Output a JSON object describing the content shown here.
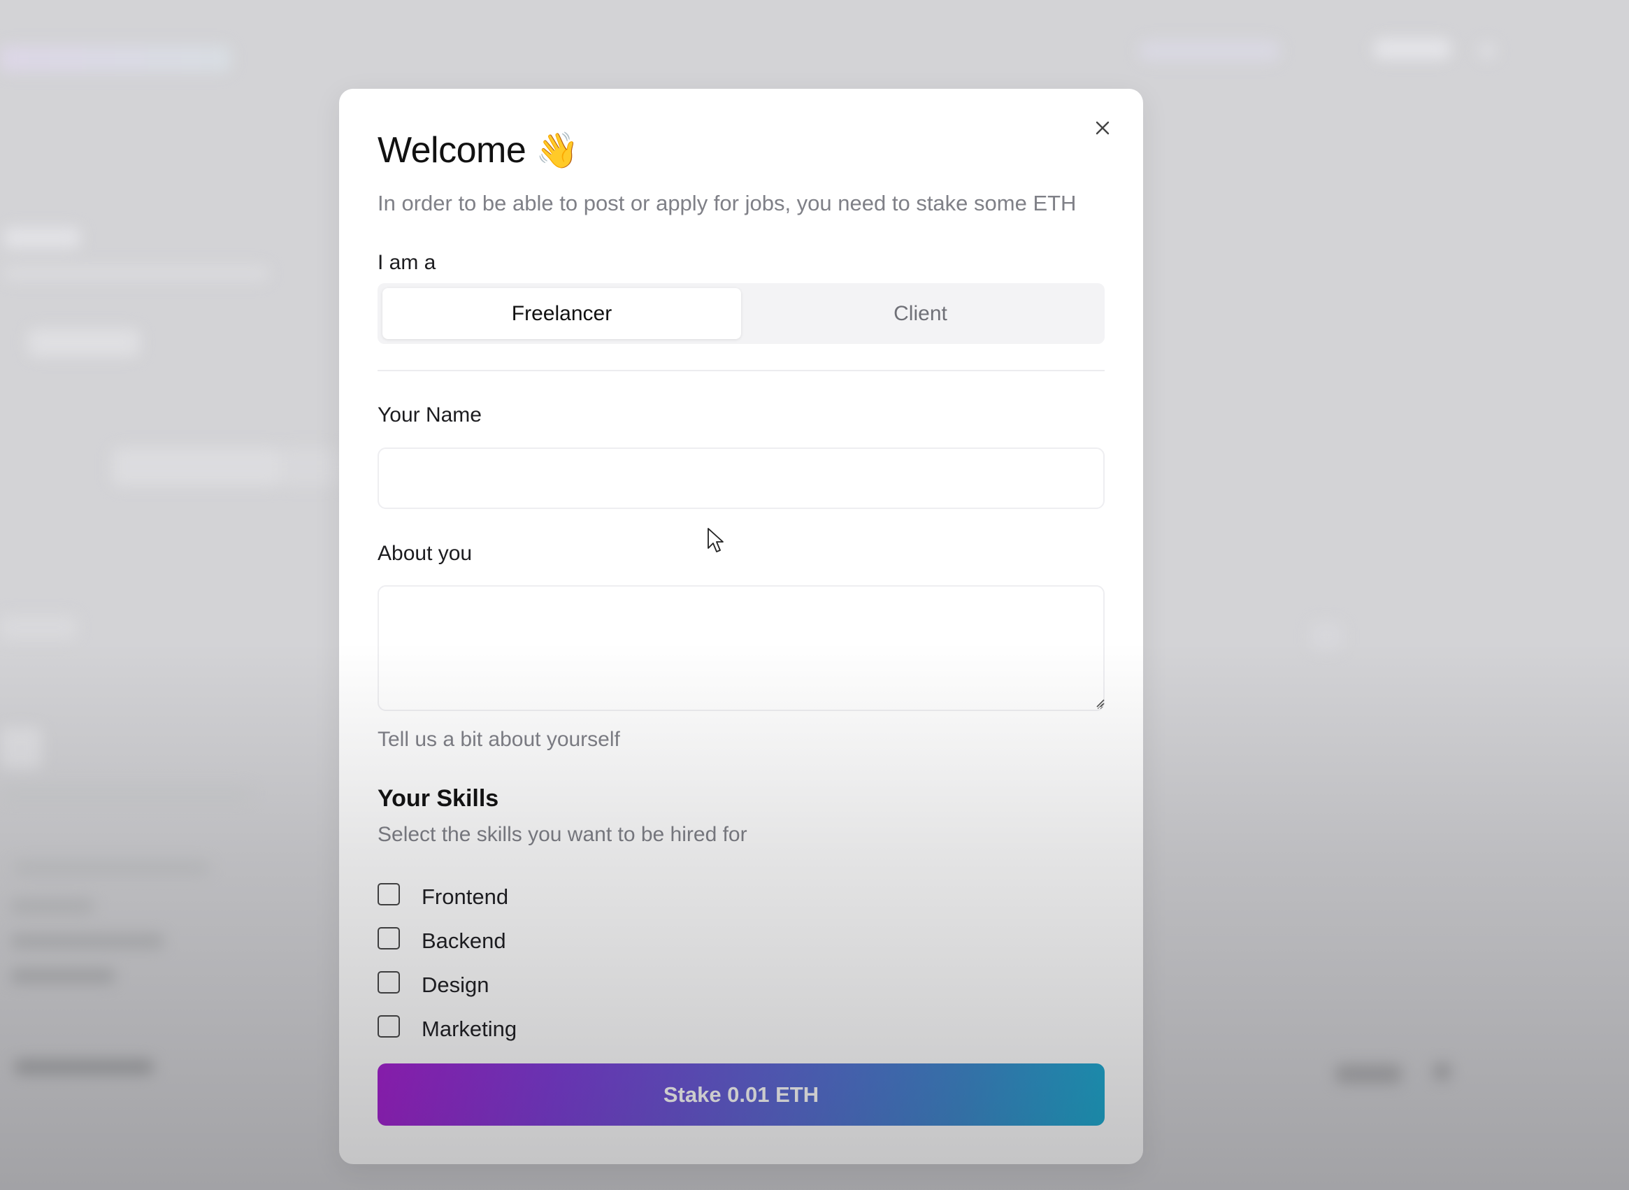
{
  "modal": {
    "title": "Welcome",
    "title_emoji": "👋",
    "subtitle": "In order to be able to post or apply for jobs, you need to stake some ETH",
    "close_icon": "close-icon",
    "role": {
      "label": "I am a",
      "options": [
        {
          "label": "Freelancer",
          "selected": true
        },
        {
          "label": "Client",
          "selected": false
        }
      ]
    },
    "name_field": {
      "label": "Your Name",
      "value": "",
      "placeholder": ""
    },
    "about_field": {
      "label": "About you",
      "value": "",
      "help_text": "Tell us a bit about yourself"
    },
    "skills": {
      "title": "Your Skills",
      "subtitle": "Select the skills you want to be hired for",
      "items": [
        {
          "label": "Frontend",
          "checked": false
        },
        {
          "label": "Backend",
          "checked": false
        },
        {
          "label": "Design",
          "checked": false
        },
        {
          "label": "Marketing",
          "checked": false
        }
      ]
    },
    "submit_label": "Stake 0.01 ETH"
  },
  "colors": {
    "button_gradient_start": "#a21ccf",
    "button_gradient_end": "#19a9cf",
    "muted_text": "#7f8087",
    "overlay": "#d3d3d6"
  }
}
